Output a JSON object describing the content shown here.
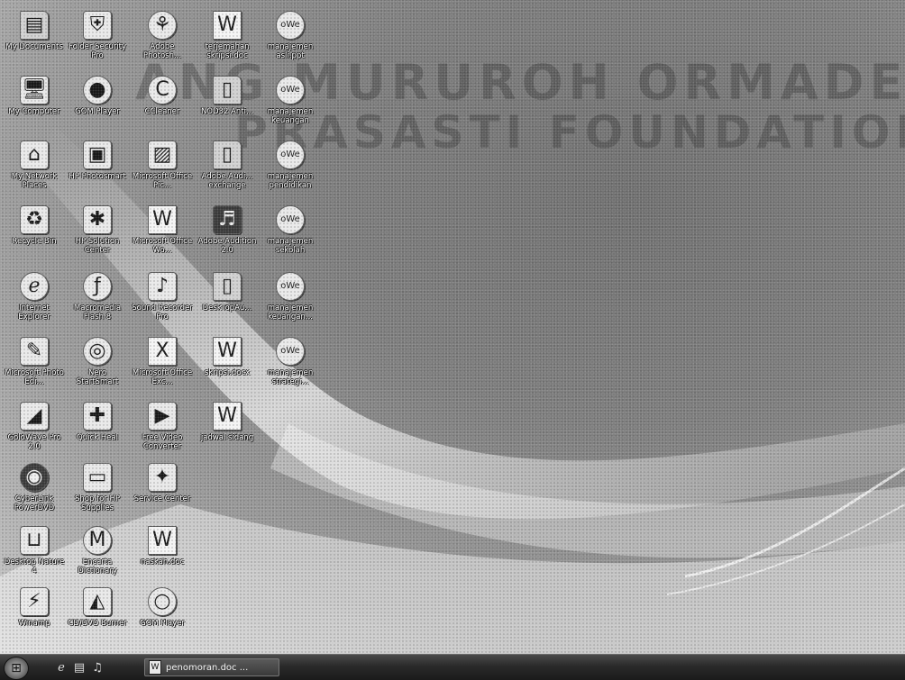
{
  "wallpaper": {
    "watermark_line1": "ANG MURUROH ORMADENHSIN",
    "watermark_line2": "PRASASTI FOUNDATION PLUTS"
  },
  "desktop_icons": [
    {
      "label": "My Documents",
      "icon": "folder-docs-icon"
    },
    {
      "label": "My Computer",
      "icon": "computer-icon"
    },
    {
      "label": "My Network Places",
      "icon": "network-icon"
    },
    {
      "label": "Recycle Bin",
      "icon": "recycle-bin-icon"
    },
    {
      "label": "Internet Explorer",
      "icon": "internet-explorer-icon"
    },
    {
      "label": "Microsoft Photo Edi...",
      "icon": "photo-editor-icon"
    },
    {
      "label": "GoldWave Pro 2.0",
      "icon": "audio-editor-icon"
    },
    {
      "label": "CyberLink PowerDVD",
      "icon": "dvd-player-icon"
    },
    {
      "label": "Desktop Nature 4",
      "icon": "desktop-app-icon"
    },
    {
      "label": "Winamp",
      "icon": "winamp-icon"
    },
    {
      "label": "Folder Security Pro",
      "icon": "folder-security-icon"
    },
    {
      "label": "GOM Player",
      "icon": "gom-player-icon"
    },
    {
      "label": "HP Photosmart",
      "icon": "camera-icon"
    },
    {
      "label": "HP Solution Center",
      "icon": "hp-solution-icon"
    },
    {
      "label": "Macromedia Flash 8",
      "icon": "flash-icon"
    },
    {
      "label": "Nero StartSmart",
      "icon": "nero-icon"
    },
    {
      "label": "Quick Heal",
      "icon": "antivirus-icon"
    },
    {
      "label": "Shop for HP Supplies",
      "icon": "shopping-icon"
    },
    {
      "label": "Encarta Dictionary",
      "icon": "dictionary-icon"
    },
    {
      "label": "CD/DVD Burner",
      "icon": "burner-icon"
    },
    {
      "label": "Adobe Photosh...",
      "icon": "photoshop-icon"
    },
    {
      "label": "CCleaner",
      "icon": "ccleaner-icon"
    },
    {
      "label": "Microsoft Office Pic...",
      "icon": "office-picture-icon"
    },
    {
      "label": "Microsoft Office Wo...",
      "icon": "word-icon"
    },
    {
      "label": "Sound Recorder Pro",
      "icon": "sound-recorder-icon"
    },
    {
      "label": "Microsoft Office Exc...",
      "icon": "excel-icon"
    },
    {
      "label": "Free Video Converter",
      "icon": "video-converter-icon"
    },
    {
      "label": "Service Center",
      "icon": "service-icon"
    },
    {
      "label": "naskah.doc",
      "icon": "word-doc-icon"
    },
    {
      "label": "GOM Player",
      "icon": "gom-player-2-icon"
    },
    {
      "label": "terjemahan skripsi.doc",
      "icon": "word-doc-icon"
    },
    {
      "label": "NOD32 Anti...",
      "icon": "folder-icon"
    },
    {
      "label": "Adobe Audi... exchange",
      "icon": "folder-icon"
    },
    {
      "label": "Adobe Audition 2.0",
      "icon": "audition-icon"
    },
    {
      "label": "DeskTopAu...",
      "icon": "folder-icon"
    },
    {
      "label": "skripsi.docx",
      "icon": "word-doc-icon"
    },
    {
      "label": "jadwal sidang",
      "icon": "word-doc-icon"
    },
    {
      "label": "manajemen asli.ppt",
      "icon": "owe-icon"
    },
    {
      "label": "manajemen keuangan",
      "icon": "owe-icon"
    },
    {
      "label": "manajemen pendidikan",
      "icon": "owe-icon"
    },
    {
      "label": "manajemen sekolah",
      "icon": "owe-icon"
    },
    {
      "label": "manajemen keuangan...",
      "icon": "owe-icon"
    },
    {
      "label": "manajemen strategi...",
      "icon": "owe-icon"
    }
  ],
  "taskbar": {
    "start_label": "start",
    "quick_launch": [
      "internet-explorer-icon",
      "show-desktop-icon",
      "media-icon"
    ],
    "active_task": "penomoran.doc ...",
    "active_task_icon": "word-doc-icon"
  }
}
